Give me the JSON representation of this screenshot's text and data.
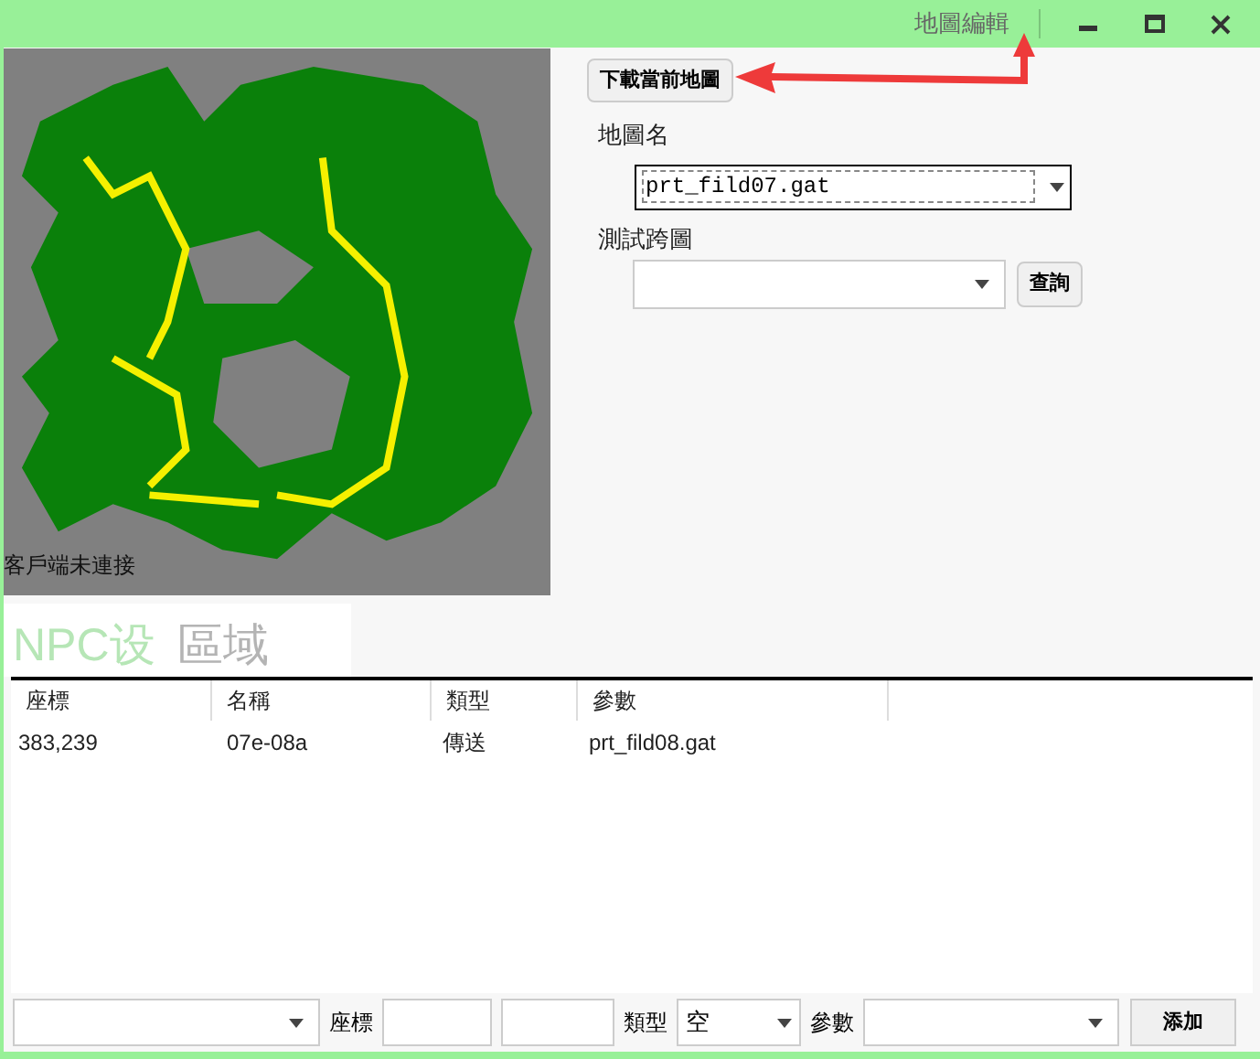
{
  "window": {
    "title": "地圖編輯"
  },
  "map": {
    "status": "客戶端未連接"
  },
  "controls": {
    "download_button": "下載當前地圖",
    "map_name_label": "地圖名",
    "map_name_value": "prt_fild07.gat",
    "test_label": "測試跨圖",
    "query_button": "查詢"
  },
  "tabs": [
    {
      "label": "NPC设",
      "selected": true
    },
    {
      "label": "區域",
      "selected": false
    }
  ],
  "table": {
    "columns": [
      "座標",
      "名稱",
      "類型",
      "參數"
    ],
    "rows": [
      [
        "383,239",
        "07e-08a",
        "傳送",
        "prt_fild08.gat"
      ]
    ]
  },
  "bottom_bar": {
    "coord_label": "座標",
    "type_label": "類型",
    "type_value": "空",
    "param_label": "參數",
    "add_button": "添加"
  }
}
